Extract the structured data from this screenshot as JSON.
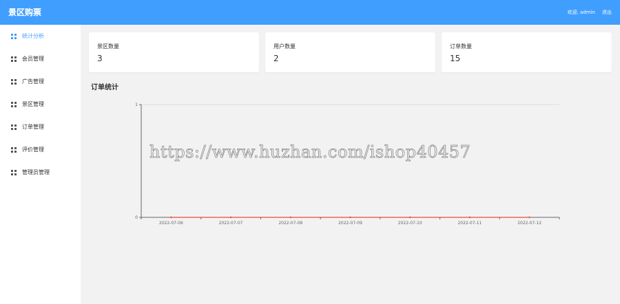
{
  "header": {
    "brand": "景区购票",
    "welcome": "欢迎, admin",
    "logout": "退出"
  },
  "sidebar": {
    "items": [
      {
        "label": "统计分析",
        "active": true
      },
      {
        "label": "会员管理",
        "active": false
      },
      {
        "label": "广告管理",
        "active": false
      },
      {
        "label": "景区管理",
        "active": false
      },
      {
        "label": "订单管理",
        "active": false
      },
      {
        "label": "评价管理",
        "active": false
      },
      {
        "label": "管理员管理",
        "active": false
      }
    ]
  },
  "cards": [
    {
      "label": "景区数量",
      "value": "3"
    },
    {
      "label": "用户数量",
      "value": "2"
    },
    {
      "label": "订单数量",
      "value": "15"
    }
  ],
  "section_title": "订单统计",
  "watermark": "https://www.huzhan.com/ishop40457",
  "colors": {
    "accent": "#409eff",
    "line": "#e74c3c"
  },
  "chart_data": {
    "type": "line",
    "categories": [
      "2022-07-06",
      "2022-07-07",
      "2022-07-08",
      "2022-07-09",
      "2022-07-10",
      "2022-07-11",
      "2022-07-12"
    ],
    "series": [
      {
        "values": [
          0,
          0,
          0,
          0,
          0,
          0,
          0
        ]
      }
    ],
    "ylim": [
      0,
      1
    ],
    "yticks": [
      "0",
      "1"
    ],
    "grid": true,
    "legend": "none"
  }
}
